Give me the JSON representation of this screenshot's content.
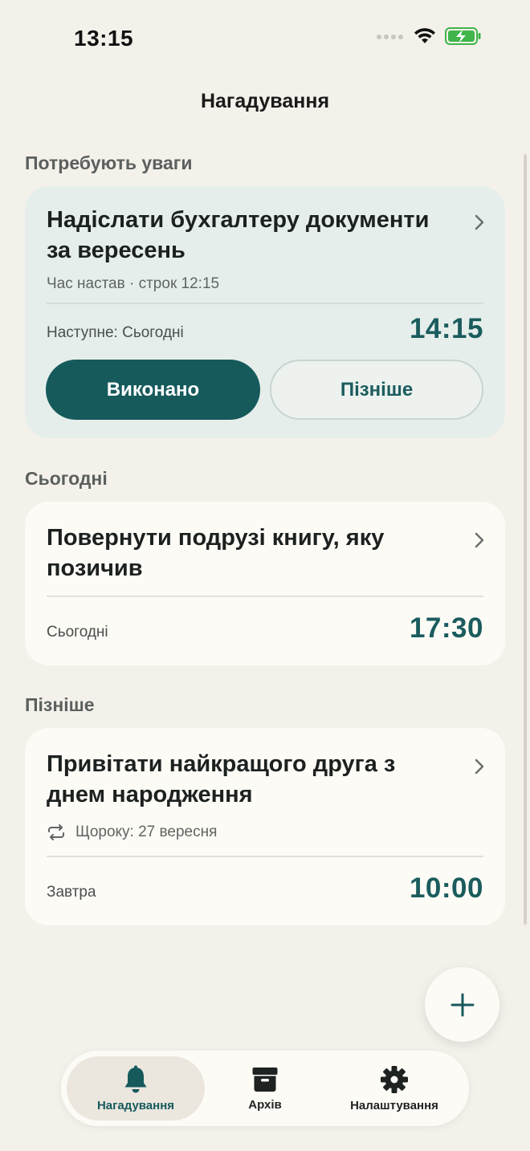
{
  "status_bar": {
    "time": "13:15"
  },
  "header": {
    "title": "Нагадування"
  },
  "sections": {
    "attention": {
      "title": "Потребують уваги",
      "card": {
        "title": "Надіслати бухгалтеру документи за вересень",
        "subtitle": "Час настав · строк 12:15",
        "next_label": "Наступне: Сьогодні",
        "time": "14:15",
        "done_button": "Виконано",
        "later_button": "Пізніше"
      }
    },
    "today": {
      "title": "Сьогодні",
      "card": {
        "title": "Повернути подрузі книгу, яку позичив",
        "date_label": "Сьогодні",
        "time": "17:30"
      }
    },
    "later": {
      "title": "Пізніше",
      "card": {
        "title": "Привітати найкращого друга з днем народження",
        "repeat": "Щороку: 27 вересня",
        "date_label": "Завтра",
        "time": "10:00"
      }
    }
  },
  "tabbar": {
    "items": [
      {
        "label": "Нагадування",
        "icon": "bell-icon",
        "active": true
      },
      {
        "label": "Архів",
        "icon": "archive-icon",
        "active": false
      },
      {
        "label": "Налаштування",
        "icon": "gear-icon",
        "active": false
      }
    ]
  },
  "colors": {
    "background": "#f4f1eb",
    "accent": "#165a5c",
    "card": "#fdfbf6",
    "attention_card": "#e5eeea"
  }
}
